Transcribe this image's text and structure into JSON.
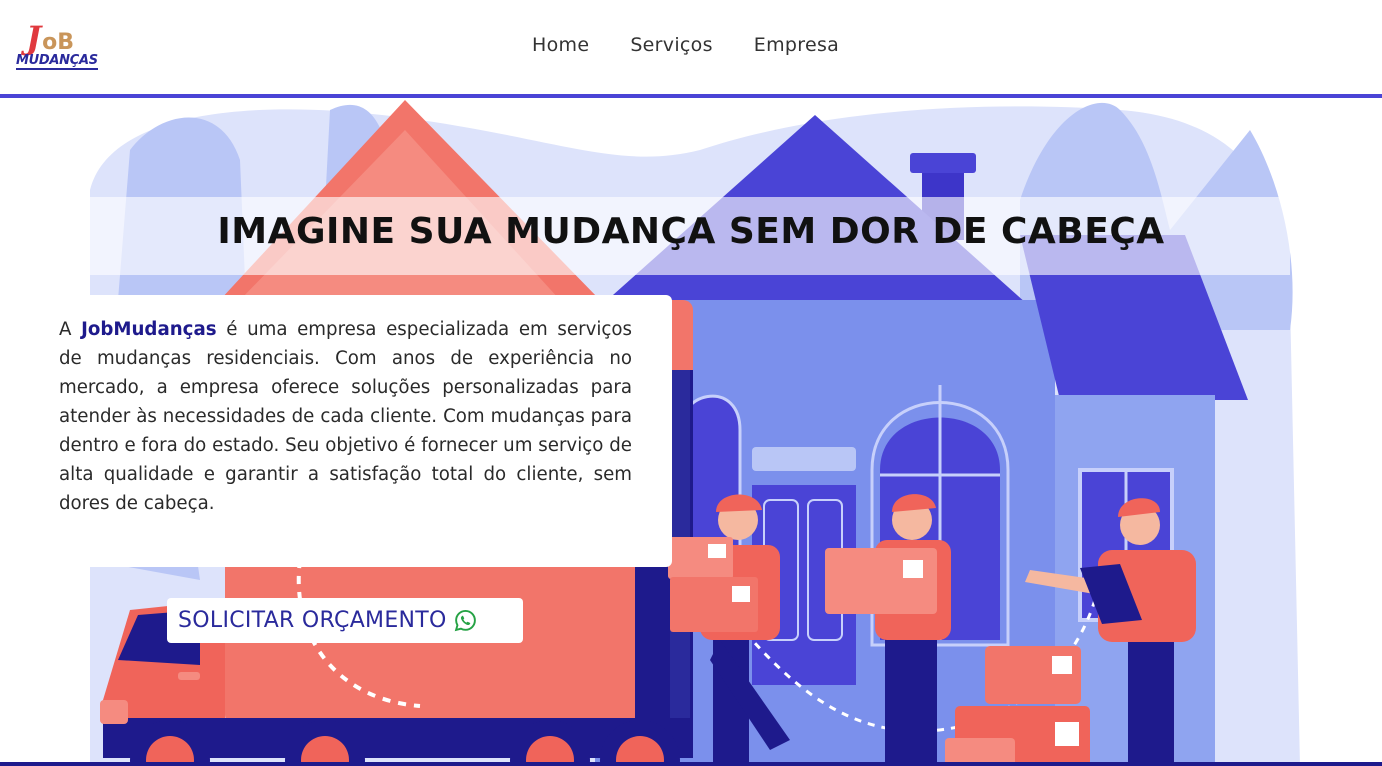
{
  "brand": {
    "logo_j": "J",
    "logo_ob": "oB",
    "logo_sub": "MUDANÇAS"
  },
  "nav": {
    "items": [
      {
        "label": "Home"
      },
      {
        "label": "Serviços"
      },
      {
        "label": "Empresa"
      }
    ]
  },
  "hero": {
    "headline": "IMAGINE SUA MUDANÇA SEM DOR DE CABEÇA",
    "about_prefix": "A ",
    "about_company": "JobMudanças",
    "about_body": " é uma empresa especializada em serviços de mudanças residenciais. Com anos de experiência no mercado, a empresa oferece soluções personalizadas para atender às necessidades de cada cliente. Com mudanças para dentro e fora do estado. Seu objetivo é fornecer um serviço de alta qualidade e garantir a satisfação total do cliente, sem dores de cabeça.",
    "cta_label": "SOLICITAR ORÇAMENTO",
    "cta_icon": "whatsapp-icon"
  },
  "colors": {
    "accent": "#4a44d6",
    "navy": "#1e1a8c",
    "coral": "#f0645a",
    "whatsapp": "#25a244"
  }
}
